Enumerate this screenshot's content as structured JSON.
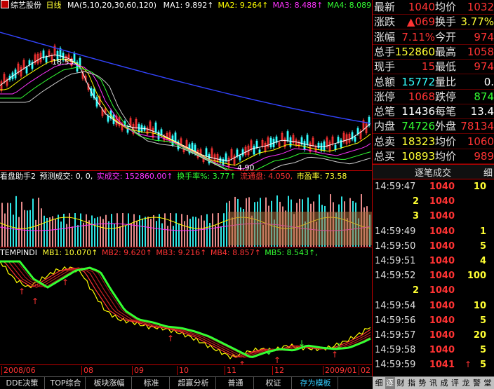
{
  "title_bar": {
    "stock": "综艺股份",
    "period": "日线",
    "ma_params": "MA(5,10,20,30,60,120)"
  },
  "ma_legend": [
    {
      "label": "MA1:",
      "value": "9.892",
      "arrow": "↑",
      "color": "#ffffff"
    },
    {
      "label": "MA2:",
      "value": "9.264",
      "arrow": "↑",
      "color": "#ffff00"
    },
    {
      "label": "MA3:",
      "value": "8.488",
      "arrow": "↑",
      "color": "#ff33ff"
    },
    {
      "label": "MA4:",
      "value": "8.089",
      "arrow": "↑",
      "color": "#33ff33"
    }
  ],
  "price_labels": {
    "high": "18.55",
    "low": "4.90"
  },
  "volume_header": {
    "name": "看盘助手2",
    "forecast": "预测成交: 0, 0,",
    "amount": "实成交: 152860.00",
    "turnover": "换手率%: 3.77",
    "circ": "流通盘: 4.050,",
    "pe": "市盈率: 73.58"
  },
  "indicator_header": {
    "name": "TEMPINDI",
    "mb1": "MB1: 10.070",
    "mb2": "MB2: 9.620",
    "mb3": "MB3: 9.216",
    "mb4": "MB4: 8.857",
    "mb5": "MB5: 8.543"
  },
  "x_axis": [
    {
      "label": "2008/06",
      "pos": 2
    },
    {
      "label": "08",
      "pos": 116
    },
    {
      "label": "09",
      "pos": 188
    },
    {
      "label": "10",
      "pos": 252
    },
    {
      "label": "11",
      "pos": 320
    },
    {
      "label": "12",
      "pos": 388
    },
    {
      "label": "2009/01",
      "pos": 460
    },
    {
      "label": "02",
      "pos": 511
    }
  ],
  "quotes": [
    {
      "l": "最新",
      "v": "1040",
      "vc": "#ff3333",
      "l2": "均价",
      "v2": "1032",
      "v2c": "#ff3333"
    },
    {
      "l": "涨跌",
      "v": "▲069",
      "vc": "#ff3333",
      "l2": "换手",
      "v2": "3.77%",
      "v2c": "#ffff33"
    },
    {
      "l": "涨幅",
      "v": "7.11%",
      "vc": "#ff3333",
      "l2": "今开",
      "v2": "974",
      "v2c": "#ff3333"
    },
    {
      "l": "总手",
      "v": "152860",
      "vc": "#ffff33",
      "l2": "最高",
      "v2": "1058",
      "v2c": "#ff3333"
    },
    {
      "l": "现手",
      "v": "15",
      "vc": "#ff3333",
      "l2": "最低",
      "v2": "974",
      "v2c": "#ff3333"
    },
    {
      "l": "总额",
      "v": "15772",
      "vc": "#33ffff",
      "l2": "量比",
      "v2": "0.",
      "v2c": "#ffffff"
    },
    {
      "l": "涨停",
      "v": "1068",
      "vc": "#ff3333",
      "l2": "跌停",
      "v2": "874",
      "v2c": "#33ff33"
    },
    {
      "l": "总笔",
      "v": "11436",
      "vc": "#ffffff",
      "l2": "每笔",
      "v2": "13.4",
      "v2c": "#ffffff"
    },
    {
      "l": "内盘",
      "v": "74726",
      "vc": "#33ff33",
      "l2": "外盘",
      "v2": "78134",
      "v2c": "#ff3333"
    },
    {
      "l": "总卖",
      "v": "18323",
      "vc": "#ffff33",
      "l2": "均价",
      "v2": "1060",
      "v2c": "#ff3333"
    },
    {
      "l": "总买",
      "v": "10893",
      "vc": "#ffff33",
      "l2": "均价",
      "v2": "989",
      "v2c": "#ff3333"
    }
  ],
  "trades_header": {
    "title": "逐笔成交",
    "btn": "细"
  },
  "trades": [
    {
      "t": "14:59:47",
      "p": "1040",
      "v": "10",
      "a": ""
    },
    {
      "t": "",
      "p": "2",
      "v": "1040",
      "a": "",
      "swap": true
    },
    {
      "t": "",
      "p": "3",
      "v": "1040",
      "a": "",
      "swap": true
    },
    {
      "t": "14:59:49",
      "p": "1040",
      "v": "1",
      "a": ""
    },
    {
      "t": "14:59:50",
      "p": "1040",
      "v": "5",
      "a": ""
    },
    {
      "t": "14:59:51",
      "p": "1040",
      "v": "4",
      "a": ""
    },
    {
      "t": "14:59:52",
      "p": "1040",
      "v": "100",
      "a": ""
    },
    {
      "t": "",
      "p": "2",
      "v": "1040",
      "a": "",
      "swap": true
    },
    {
      "t": "14:59:54",
      "p": "1040",
      "v": "10",
      "a": ""
    },
    {
      "t": "14:59:56",
      "p": "1040",
      "v": "5",
      "a": ""
    },
    {
      "t": "14:59:57",
      "p": "1040",
      "v": "20",
      "a": ""
    },
    {
      "t": "14:59:58",
      "p": "1040",
      "v": "5",
      "a": ""
    },
    {
      "t": "14:59:59",
      "p": "1041",
      "v": "5",
      "a": "↑"
    }
  ],
  "bottom_tabs": [
    {
      "label": "DDE决策",
      "w": 64
    },
    {
      "label": "TOP综合",
      "w": 56
    },
    {
      "label": "板块涨幅",
      "w": 64
    },
    {
      "label": "标准",
      "w": 52
    },
    {
      "label": "超赢分析",
      "w": 64
    },
    {
      "label": "普通",
      "w": 52
    },
    {
      "label": "权证",
      "w": 52
    },
    {
      "label": "存为模板",
      "w": 64,
      "active": true
    }
  ],
  "tools": [
    "细",
    "逐",
    "财",
    "指",
    "势",
    "讯",
    "成",
    "评",
    "龙",
    "警",
    "堂"
  ],
  "colors": {
    "up": "#ff3333",
    "down": "#33ffff",
    "border": "#c00000"
  }
}
